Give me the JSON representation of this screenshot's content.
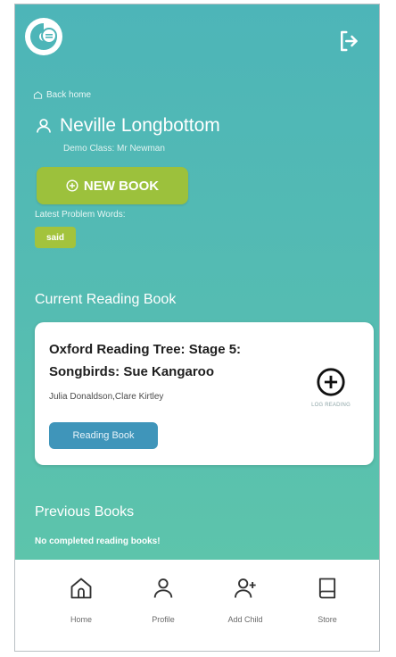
{
  "header": {
    "back_home": "Back home"
  },
  "student": {
    "name": "Neville Longbottom",
    "class": "Demo Class: Mr Newman"
  },
  "actions": {
    "new_book": "NEW BOOK"
  },
  "problem_words": {
    "label": "Latest Problem Words:",
    "words": [
      "said"
    ]
  },
  "current": {
    "section_title": "Current Reading Book",
    "book": {
      "title": "Oxford Reading Tree: Stage 5: Songbirds: Sue Kangaroo",
      "authors": "Julia Donaldson,Clare Kirtley",
      "type_button": "Reading Book",
      "log_label": "LOG READING"
    }
  },
  "previous": {
    "section_title": "Previous Books",
    "empty_text": "No completed reading books!"
  },
  "nav": {
    "items": [
      {
        "label": "Home",
        "icon": "home-icon"
      },
      {
        "label": "Profile",
        "icon": "profile-icon"
      },
      {
        "label": "Add Child",
        "icon": "add-user-icon"
      },
      {
        "label": "Store",
        "icon": "book-icon"
      }
    ]
  },
  "colors": {
    "teal": "#4db5b8",
    "green": "#9cc13c",
    "blue_button": "#3f95ba"
  }
}
